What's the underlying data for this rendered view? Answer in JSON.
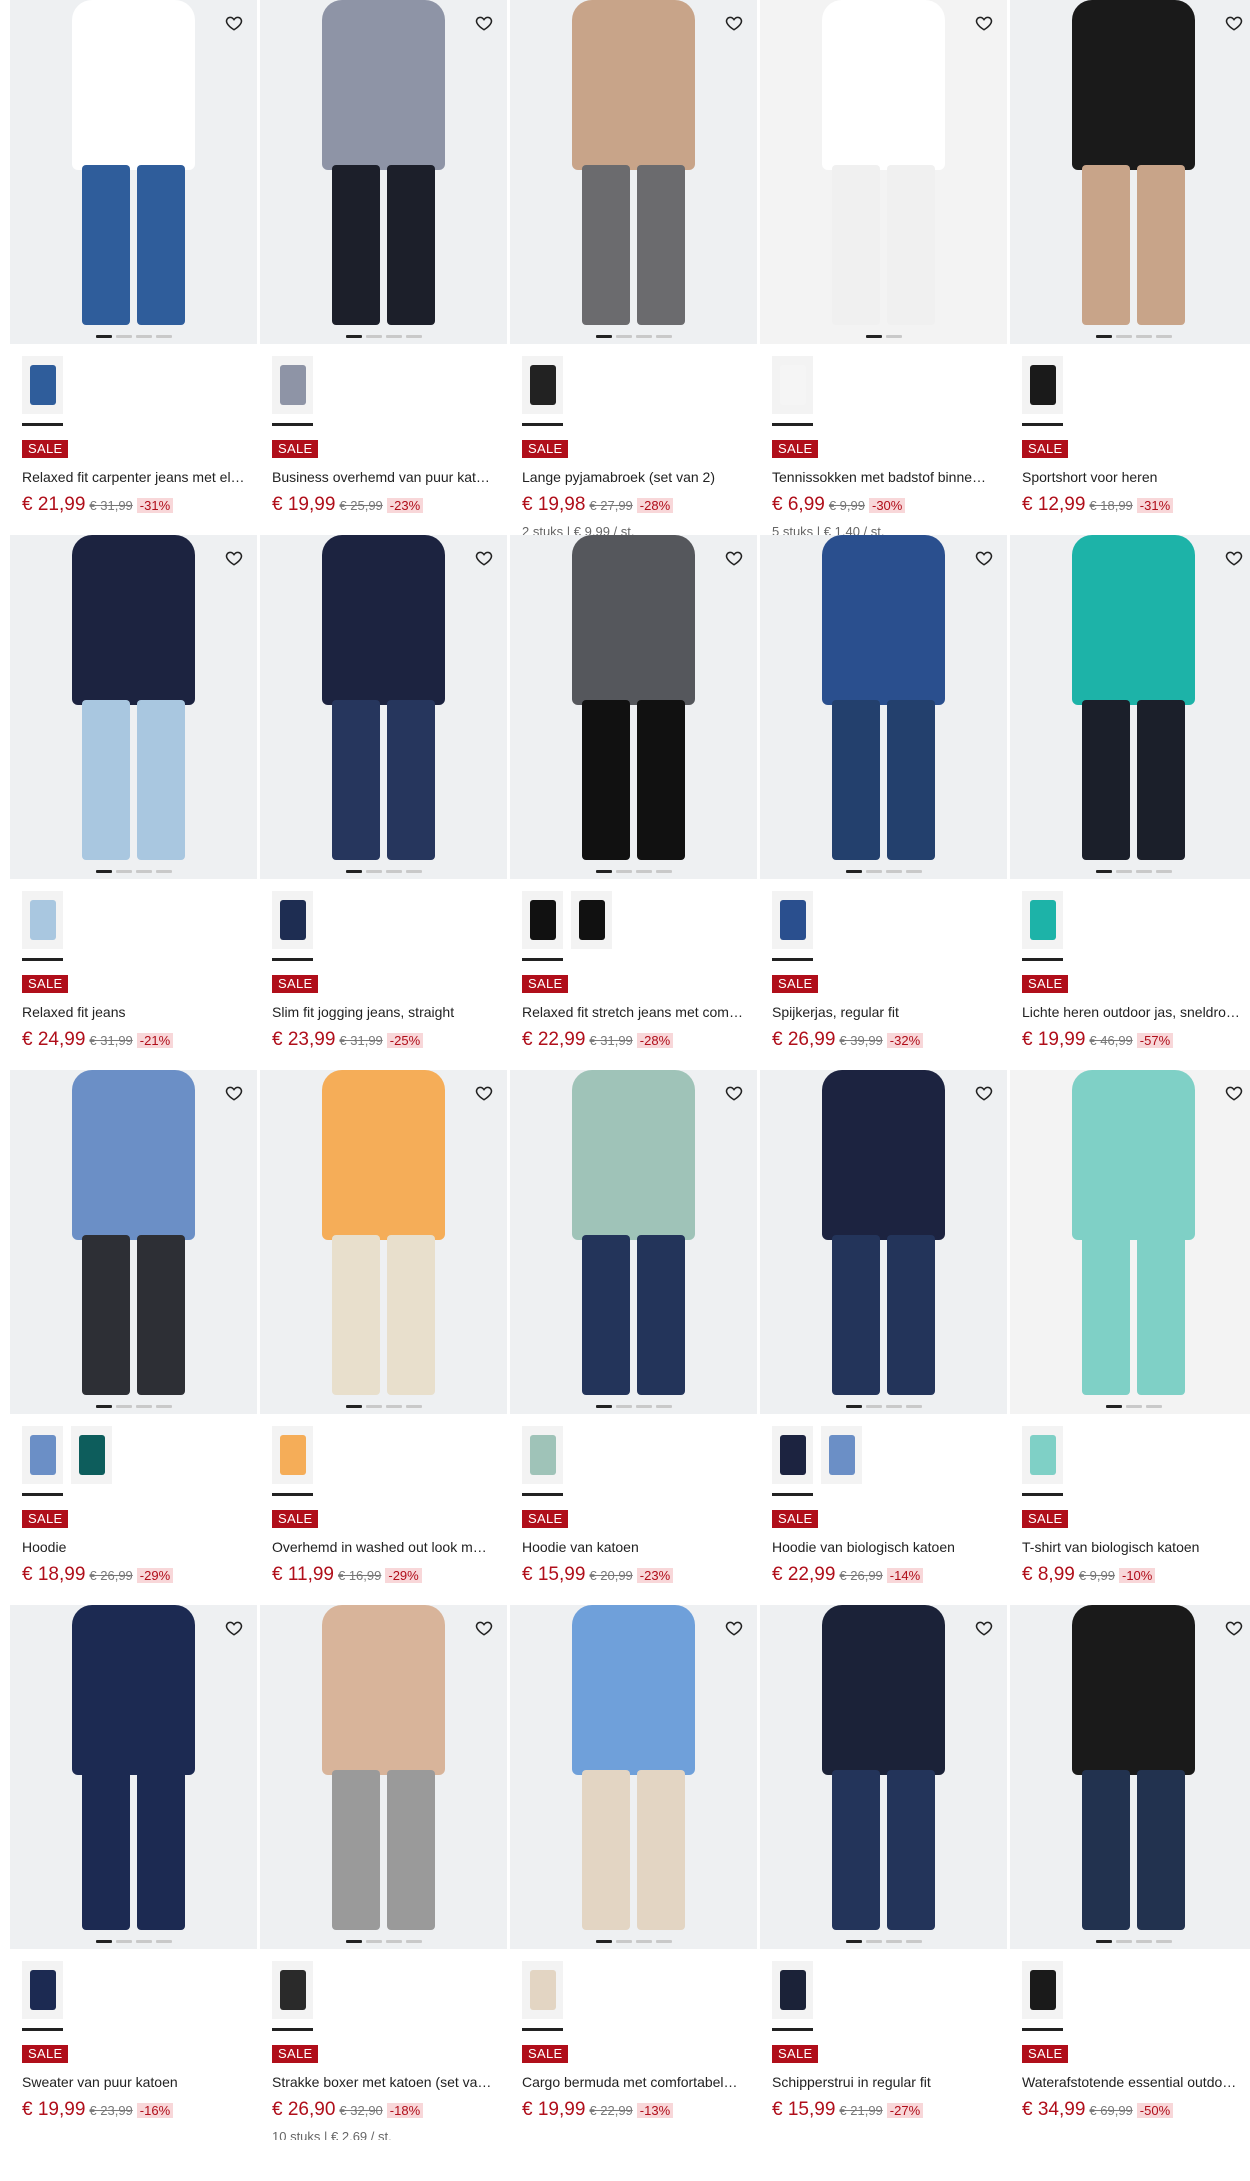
{
  "labels": {
    "sale": "SALE"
  },
  "colors": {
    "sale": "#b00e1a",
    "discount_bg": "#f8d7d9"
  },
  "products": [
    {
      "title": "Relaxed fit carpenter jeans met el…",
      "price": "€ 21,99",
      "old": "€ 31,99",
      "disc": "-31%",
      "unit": "",
      "dots": 4,
      "swatches": [
        "#2f5d9b"
      ],
      "bg": "#eef0f2",
      "top": "#ffffff",
      "bottom": "#2f5d9b",
      "icon": "heart-icon"
    },
    {
      "title": "Business overhemd van puur kat…",
      "price": "€ 19,99",
      "old": "€ 25,99",
      "disc": "-23%",
      "unit": "",
      "dots": 4,
      "swatches": [
        "#8e94a6"
      ],
      "bg": "#eef0f2",
      "top": "#8e94a6",
      "bottom": "#1c1f2a",
      "icon": "heart-icon"
    },
    {
      "title": "Lange pyjamabroek (set van 2)",
      "price": "€ 19,98",
      "old": "€ 27,99",
      "disc": "-28%",
      "unit": "2 stuks | € 9,99 / st.",
      "dots": 4,
      "swatches": [
        "#222222"
      ],
      "bg": "#eef0f2",
      "top": "#c8a489",
      "bottom": "#6b6b6e",
      "icon": "heart-icon"
    },
    {
      "title": "Tennissokken met badstof binne…",
      "price": "€ 6,99",
      "old": "€ 9,99",
      "disc": "-30%",
      "unit": "5 stuks | € 1,40 / st.",
      "dots": 2,
      "swatches": [
        "#f5f5f5"
      ],
      "bg": "#f3f3f3",
      "top": "#ffffff",
      "bottom": "#f0f0f0",
      "icon": "heart-icon"
    },
    {
      "title": "Sportshort voor heren",
      "price": "€ 12,99",
      "old": "€ 18,99",
      "disc": "-31%",
      "unit": "",
      "dots": 4,
      "swatches": [
        "#1a1a1a"
      ],
      "bg": "#eef0f2",
      "top": "#1a1a1a",
      "bottom": "#c8a489",
      "icon": "heart-icon"
    },
    {
      "title": "Relaxed fit jeans",
      "price": "€ 24,99",
      "old": "€ 31,99",
      "disc": "-21%",
      "unit": "",
      "dots": 4,
      "swatches": [
        "#a9c7e0"
      ],
      "bg": "#eef0f2",
      "top": "#1c2340",
      "bottom": "#a9c7e0",
      "icon": "heart-icon"
    },
    {
      "title": "Slim fit jogging jeans, straight",
      "price": "€ 23,99",
      "old": "€ 31,99",
      "disc": "-25%",
      "unit": "",
      "dots": 4,
      "swatches": [
        "#1e2d52"
      ],
      "bg": "#eef0f2",
      "top": "#1c2340",
      "bottom": "#26365d",
      "icon": "heart-icon"
    },
    {
      "title": "Relaxed fit stretch jeans met com…",
      "price": "€ 22,99",
      "old": "€ 31,99",
      "disc": "-28%",
      "unit": "",
      "dots": 4,
      "swatches": [
        "#111111",
        "#111111"
      ],
      "bg": "#eef0f2",
      "top": "#55575c",
      "bottom": "#111111",
      "icon": "heart-icon"
    },
    {
      "title": "Spijkerjas, regular fit",
      "price": "€ 26,99",
      "old": "€ 39,99",
      "disc": "-32%",
      "unit": "",
      "dots": 4,
      "swatches": [
        "#2a4f8e"
      ],
      "bg": "#eef0f2",
      "top": "#2a4f8e",
      "bottom": "#23406d",
      "icon": "heart-icon"
    },
    {
      "title": "Lichte heren outdoor jas, sneldro…",
      "price": "€ 19,99",
      "old": "€ 46,99",
      "disc": "-57%",
      "unit": "",
      "dots": 4,
      "swatches": [
        "#1db3a8"
      ],
      "bg": "#eef0f2",
      "top": "#1db3a8",
      "bottom": "#1b1f2a",
      "icon": "heart-icon"
    },
    {
      "title": "Hoodie",
      "price": "€ 18,99",
      "old": "€ 26,99",
      "disc": "-29%",
      "unit": "",
      "dots": 4,
      "swatches": [
        "#6b8fc6",
        "#0d5d5c"
      ],
      "bg": "#eef0f2",
      "top": "#6b8fc6",
      "bottom": "#2d2f35",
      "icon": "heart-icon"
    },
    {
      "title": "Overhemd in washed out look m…",
      "price": "€ 11,99",
      "old": "€ 16,99",
      "disc": "-29%",
      "unit": "",
      "dots": 4,
      "swatches": [
        "#f5ad58"
      ],
      "bg": "#eef0f2",
      "top": "#f5ad58",
      "bottom": "#e8dfcc",
      "icon": "heart-icon"
    },
    {
      "title": "Hoodie van katoen",
      "price": "€ 15,99",
      "old": "€ 20,99",
      "disc": "-23%",
      "unit": "",
      "dots": 4,
      "swatches": [
        "#9fc3b8"
      ],
      "bg": "#eef0f2",
      "top": "#9fc3b8",
      "bottom": "#23345a",
      "icon": "heart-icon"
    },
    {
      "title": "Hoodie van biologisch katoen",
      "price": "€ 22,99",
      "old": "€ 26,99",
      "disc": "-14%",
      "unit": "",
      "dots": 4,
      "swatches": [
        "#1c2340",
        "#6b8fc6"
      ],
      "bg": "#eef0f2",
      "top": "#1c2340",
      "bottom": "#23345a",
      "icon": "heart-icon"
    },
    {
      "title": "T-shirt van biologisch katoen",
      "price": "€ 8,99",
      "old": "€ 9,99",
      "disc": "-10%",
      "unit": "",
      "dots": 3,
      "swatches": [
        "#7fd0c6"
      ],
      "bg": "#f3f3f3",
      "top": "#7fd0c6",
      "bottom": "#7fd0c6",
      "icon": "heart-icon"
    },
    {
      "title": "Sweater van puur katoen",
      "price": "€ 19,99",
      "old": "€ 23,99",
      "disc": "-16%",
      "unit": "",
      "dots": 4,
      "swatches": [
        "#1c2a52"
      ],
      "bg": "#eef0f2",
      "top": "#1c2a52",
      "bottom": "#1c2a52",
      "icon": "heart-icon"
    },
    {
      "title": "Strakke boxer met katoen (set va…",
      "price": "€ 26,90",
      "old": "€ 32,90",
      "disc": "-18%",
      "unit": "10 stuks | € 2,69 / st.",
      "dots": 4,
      "swatches": [
        "#2a2a2a"
      ],
      "bg": "#eef0f2",
      "top": "#d8b49a",
      "bottom": "#9a9a9a",
      "icon": "heart-icon"
    },
    {
      "title": "Cargo bermuda met comfortabel…",
      "price": "€ 19,99",
      "old": "€ 22,99",
      "disc": "-13%",
      "unit": "",
      "dots": 4,
      "swatches": [
        "#e3d5c3"
      ],
      "bg": "#eef0f2",
      "top": "#6fa0da",
      "bottom": "#e3d5c3",
      "icon": "heart-icon"
    },
    {
      "title": "Schipperstrui in regular fit",
      "price": "€ 15,99",
      "old": "€ 21,99",
      "disc": "-27%",
      "unit": "",
      "dots": 4,
      "swatches": [
        "#1b2238"
      ],
      "bg": "#eef0f2",
      "top": "#1b2238",
      "bottom": "#23345a",
      "icon": "heart-icon"
    },
    {
      "title": "Waterafstotende essential outdo…",
      "price": "€ 34,99",
      "old": "€ 69,99",
      "disc": "-50%",
      "unit": "",
      "dots": 4,
      "swatches": [
        "#1a1a1a"
      ],
      "bg": "#eef0f2",
      "top": "#1a1a1a",
      "bottom": "#22324f",
      "icon": "heart-icon"
    }
  ]
}
